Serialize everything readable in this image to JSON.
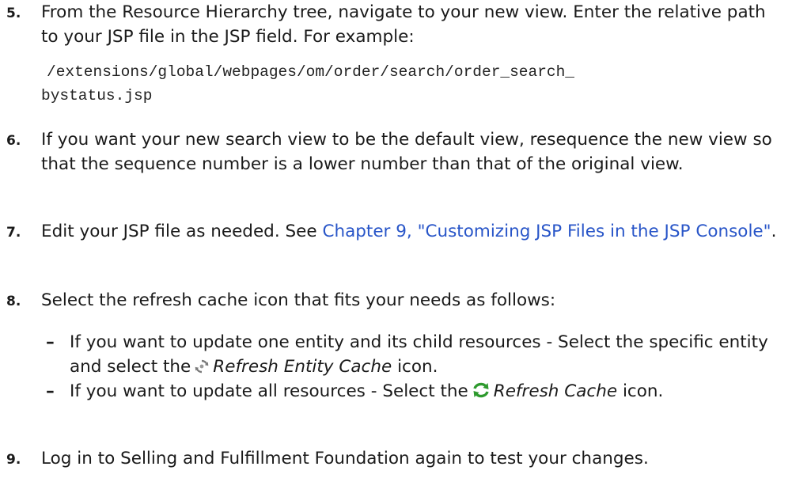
{
  "steps": [
    {
      "num": "5.",
      "text": "From the Resource Hierarchy tree, navigate to your new view. Enter the relative path to your JSP file in the JSP field. For example:",
      "code_line1": "/extensions/global/webpages/om/order/search/order_search_",
      "code_line2": "bystatus.jsp"
    },
    {
      "num": "6.",
      "text": "If you want your new search view to be the default view, resequence the new view so that the sequence number is a lower number than that of the original view."
    },
    {
      "num": "7.",
      "text_before": "Edit your JSP file as needed. See ",
      "link": "Chapter 9, \"Customizing JSP Files in the JSP Console\"",
      "text_after": "."
    },
    {
      "num": "8.",
      "text": "Select the refresh cache icon that fits your needs as follows:",
      "bullets": [
        {
          "dash": "–",
          "text_before": "If you want to update one entity and its child resources - Select the specific entity and select the",
          "icon": "refresh-entity-cache-icon",
          "em": "Refresh Entity Cache",
          "text_after": "icon."
        },
        {
          "dash": "–",
          "text_before": "If you want to update all resources - Select the",
          "icon": "refresh-cache-icon",
          "em": "Refresh Cache",
          "text_after": "icon."
        }
      ]
    },
    {
      "num": "9.",
      "text": "Log in to Selling and Fulfillment Foundation again to test your changes."
    }
  ],
  "colors": {
    "link": "#2855c8",
    "text": "#1a1a1a",
    "refresh_green": "#2e9a2e"
  }
}
